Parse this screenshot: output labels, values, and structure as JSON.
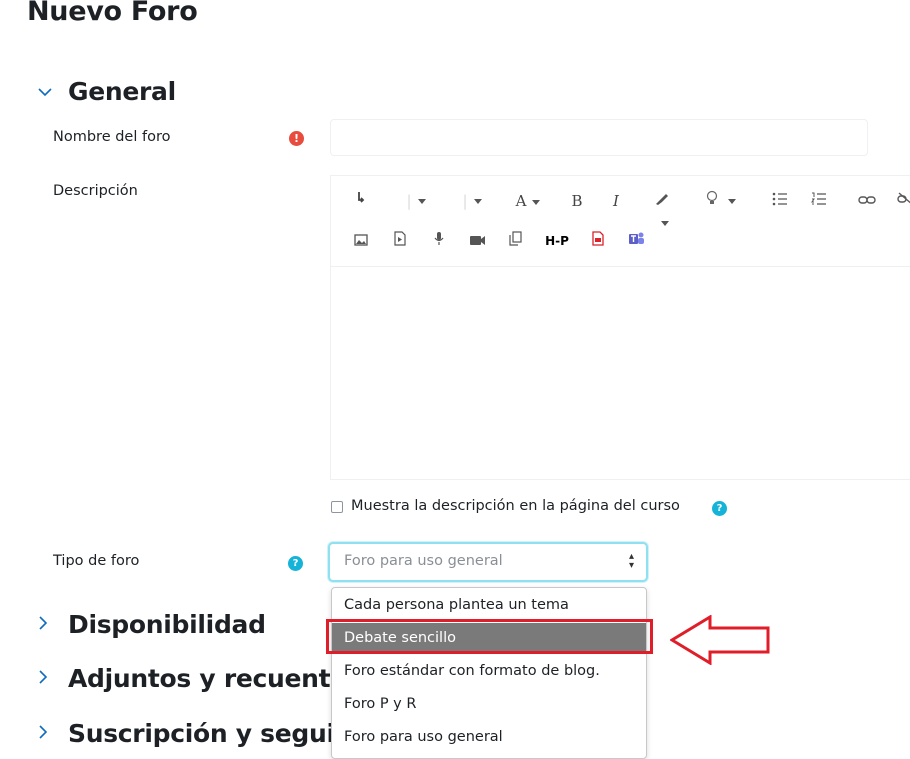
{
  "page": {
    "title": "Nuevo Foro"
  },
  "sections": {
    "general": {
      "title": "General",
      "chevron": "chevron-down-icon"
    },
    "disponibilidad": {
      "title": "Disponibilidad",
      "chevron": "chevron-right-icon"
    },
    "adjuntos": {
      "title": "Adjuntos y recuent",
      "chevron": "chevron-right-icon"
    },
    "suscripcion": {
      "title": "Suscripción y segui",
      "chevron": "chevron-right-icon"
    }
  },
  "form": {
    "forum_name": {
      "label": "Nombre del foro",
      "value": "",
      "required_icon": "exclamation-icon"
    },
    "description": {
      "label": "Descripción"
    },
    "show_description": {
      "label": "Muestra la descripción en la página del curso",
      "checked": false
    },
    "forum_type": {
      "label": "Tipo de foro",
      "value": "Foro para uso general",
      "options": [
        "Cada persona plantea un tema",
        "Debate sencillo",
        "Foro estándar con formato de blog.",
        "Foro P y R",
        "Foro para uso general"
      ],
      "highlighted_option": "Debate sencillo"
    }
  },
  "editor": {
    "toolbar_row1": [
      "expand-icon",
      "paragraph-style-icon",
      "font-size-icon",
      "font-color-icon",
      "bold-icon",
      "italic-icon",
      "highlight-icon",
      "lightbulb-icon",
      "bulleted-list-icon",
      "numbered-list-icon",
      "link-icon",
      "unlink-icon"
    ],
    "toolbar_row2": [
      "image-icon",
      "media-icon",
      "microphone-icon",
      "video-icon",
      "copy-icon",
      "h5p-icon",
      "pdf-icon",
      "teams-icon"
    ],
    "bold_glyph": "B",
    "italic_glyph": "I",
    "font_glyph": "A",
    "h5p_glyph": "H-P"
  },
  "colors": {
    "accent": "#0f6cbf",
    "required": "#e74c3c",
    "help": "#16b3d9",
    "highlight_border": "#e01e2a",
    "selected_option_bg": "#7a7a7a"
  },
  "annotation": {
    "arrow_icon": "left-arrow-icon",
    "box": "highlight-box"
  }
}
